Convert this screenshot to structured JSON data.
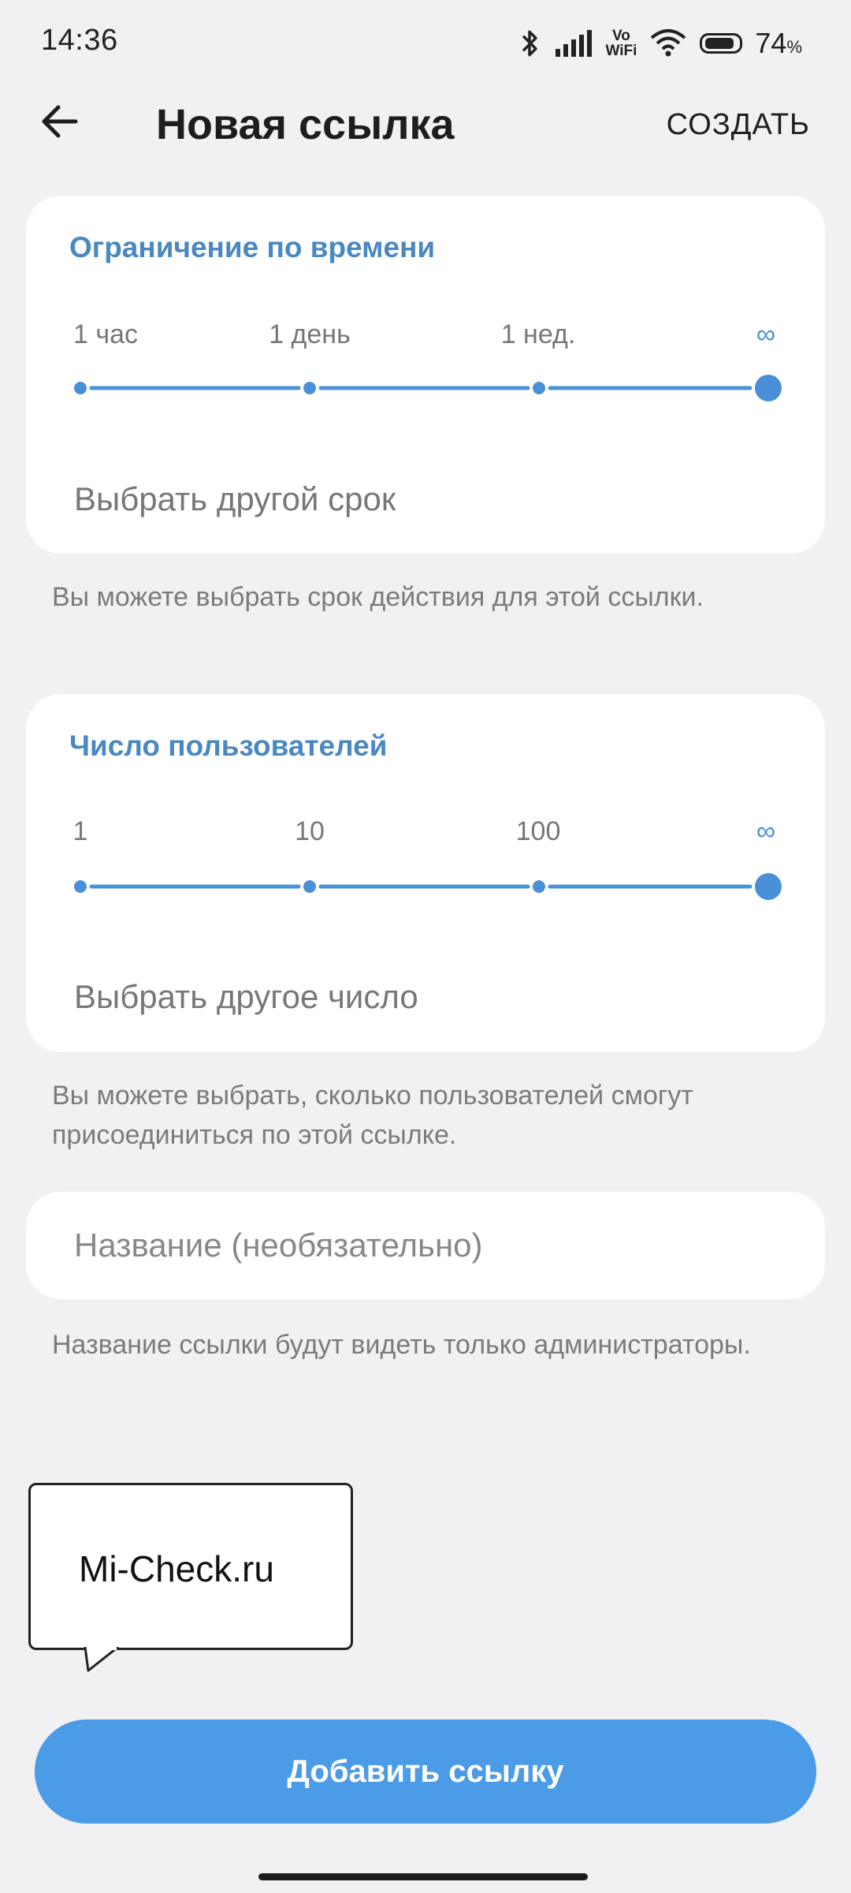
{
  "status_bar": {
    "time": "14:36",
    "volte_top": "Vo",
    "volte_bottom": "WiFi",
    "battery_percent": "74",
    "percent_sign": "%"
  },
  "header": {
    "title": "Новая ссылка",
    "create_label": "СОЗДАТЬ"
  },
  "time_limit": {
    "title": "Ограничение по времени",
    "ticks": [
      "1 час",
      "1 день",
      "1 нед.",
      "∞"
    ],
    "selected_index": 3,
    "choose_label": "Выбрать другой срок",
    "hint": "Вы можете выбрать срок действия для этой ссылки."
  },
  "user_limit": {
    "title": "Число пользователей",
    "ticks": [
      "1",
      "10",
      "100",
      "∞"
    ],
    "selected_index": 3,
    "choose_label": "Выбрать другое число",
    "hint": "Вы можете выбрать, сколько пользователей смогут присоединиться по этой ссылке."
  },
  "name_field": {
    "placeholder": "Название (необязательно)",
    "hint": "Название ссылки будут видеть только администраторы."
  },
  "watermark": "Mi-Check.ru",
  "add_button_label": "Добавить ссылку",
  "colors": {
    "accent": "#4a90d9",
    "button": "#4b9be6",
    "card_title": "#4a88c2",
    "background": "#f1f1f4"
  }
}
